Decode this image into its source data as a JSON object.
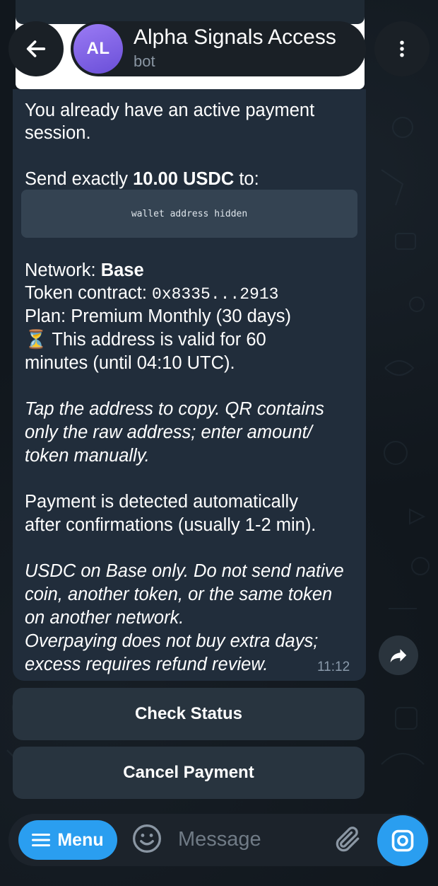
{
  "header": {
    "avatar_initials": "AL",
    "title": "Alpha Signals Access",
    "subtitle": "bot"
  },
  "message": {
    "line1": "You already have an active payment",
    "line2": "session.",
    "send_prefix": "Send exactly ",
    "send_amount": "10.00 USDC",
    "send_suffix": " to:",
    "address_placeholder": "wallet address hidden",
    "network_label": "Network: ",
    "network_value": "Base",
    "contract_label": "Token contract: ",
    "contract_value": "0x8335...2913",
    "plan": "Plan: Premium Monthly (30 days)",
    "validity_emoji": "⏳",
    "validity_1": " This address is valid for 60",
    "validity_2": "minutes (until 04:10 UTC).",
    "tap_1": "Tap the address to copy. QR contains",
    "tap_2": "only the raw address; enter amount/",
    "tap_3": "token manually.",
    "detect_1": "Payment is detected automatically",
    "detect_2": "after confirmations (usually 1-2 min).",
    "warn_1": "USDC on Base only. Do not send native",
    "warn_2": "coin, another token, or the same token",
    "warn_3": "on another network.",
    "warn_4": "Overpaying does not buy extra days;",
    "warn_5": "excess requires refund review.",
    "time": "11:12"
  },
  "buttons": {
    "check_status": "Check Status",
    "cancel_payment": "Cancel Payment"
  },
  "composer": {
    "menu_label": "Menu",
    "placeholder": "Message"
  },
  "icons": {
    "back": "arrow-left-icon",
    "more": "more-vertical-icon",
    "share": "share-icon",
    "emoji": "emoji-icon",
    "attach": "paperclip-icon",
    "camera": "camera-icon",
    "menu": "hamburger-icon"
  },
  "colors": {
    "accent": "#2a9ef0",
    "bubble": "#212d3b",
    "avatar": "#8a6cf0"
  }
}
